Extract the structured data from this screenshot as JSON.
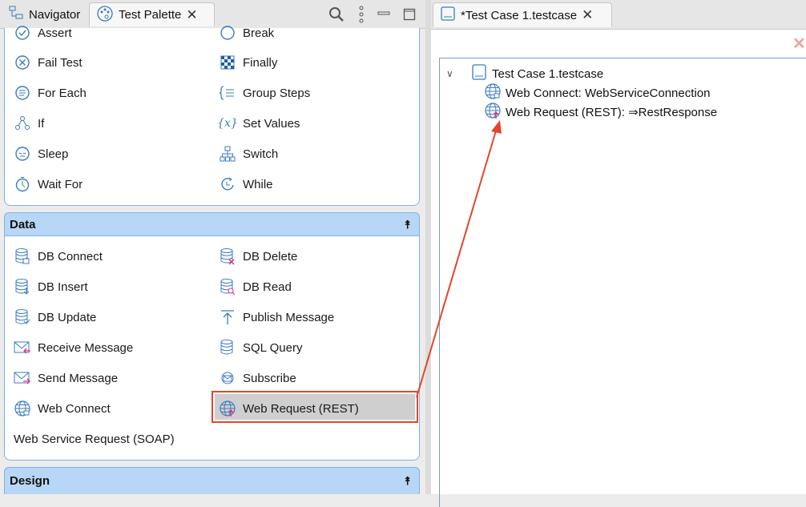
{
  "tabs": {
    "navigator": "Navigator",
    "palette": "Test Palette",
    "editor": "*Test Case 1.testcase"
  },
  "flow_items": [
    {
      "label": "Assert",
      "icon": "assert-icon"
    },
    {
      "label": "Break",
      "icon": "break-icon"
    },
    {
      "label": "Fail Test",
      "icon": "fail-test-icon"
    },
    {
      "label": "Finally",
      "icon": "finally-icon"
    },
    {
      "label": "For Each",
      "icon": "for-each-icon"
    },
    {
      "label": "Group Steps",
      "icon": "group-steps-icon"
    },
    {
      "label": "If",
      "icon": "if-icon"
    },
    {
      "label": "Set Values",
      "icon": "set-values-icon"
    },
    {
      "label": "Sleep",
      "icon": "sleep-icon"
    },
    {
      "label": "Switch",
      "icon": "switch-icon"
    },
    {
      "label": "Wait For",
      "icon": "wait-for-icon"
    },
    {
      "label": "While",
      "icon": "while-icon"
    }
  ],
  "data_section": {
    "title": "Data",
    "items": [
      {
        "label": "DB Connect",
        "icon": "db-connect-icon"
      },
      {
        "label": "DB Delete",
        "icon": "db-delete-icon"
      },
      {
        "label": "DB Insert",
        "icon": "db-insert-icon"
      },
      {
        "label": "DB Read",
        "icon": "db-read-icon"
      },
      {
        "label": "DB Update",
        "icon": "db-update-icon"
      },
      {
        "label": "Publish Message",
        "icon": "publish-message-icon"
      },
      {
        "label": "Receive Message",
        "icon": "receive-message-icon"
      },
      {
        "label": "SQL Query",
        "icon": "sql-query-icon"
      },
      {
        "label": "Send Message",
        "icon": "send-message-icon"
      },
      {
        "label": "Subscribe",
        "icon": "subscribe-icon"
      },
      {
        "label": "Web Connect",
        "icon": "web-connect-icon"
      },
      {
        "label": "Web Request (REST)",
        "icon": "web-request-icon"
      },
      {
        "label": "Web Service Request (SOAP)",
        "icon": ""
      }
    ]
  },
  "design_section": {
    "title": "Design"
  },
  "tree": {
    "root": "Test Case 1.testcase",
    "children": [
      "Web Connect: WebServiceConnection",
      "Web Request (REST): ⇒RestResponse"
    ]
  },
  "colors": {
    "accent_blue": "#b8d6f5",
    "highlight_red": "#e2452b",
    "selected_gray": "#cfcfcf"
  }
}
